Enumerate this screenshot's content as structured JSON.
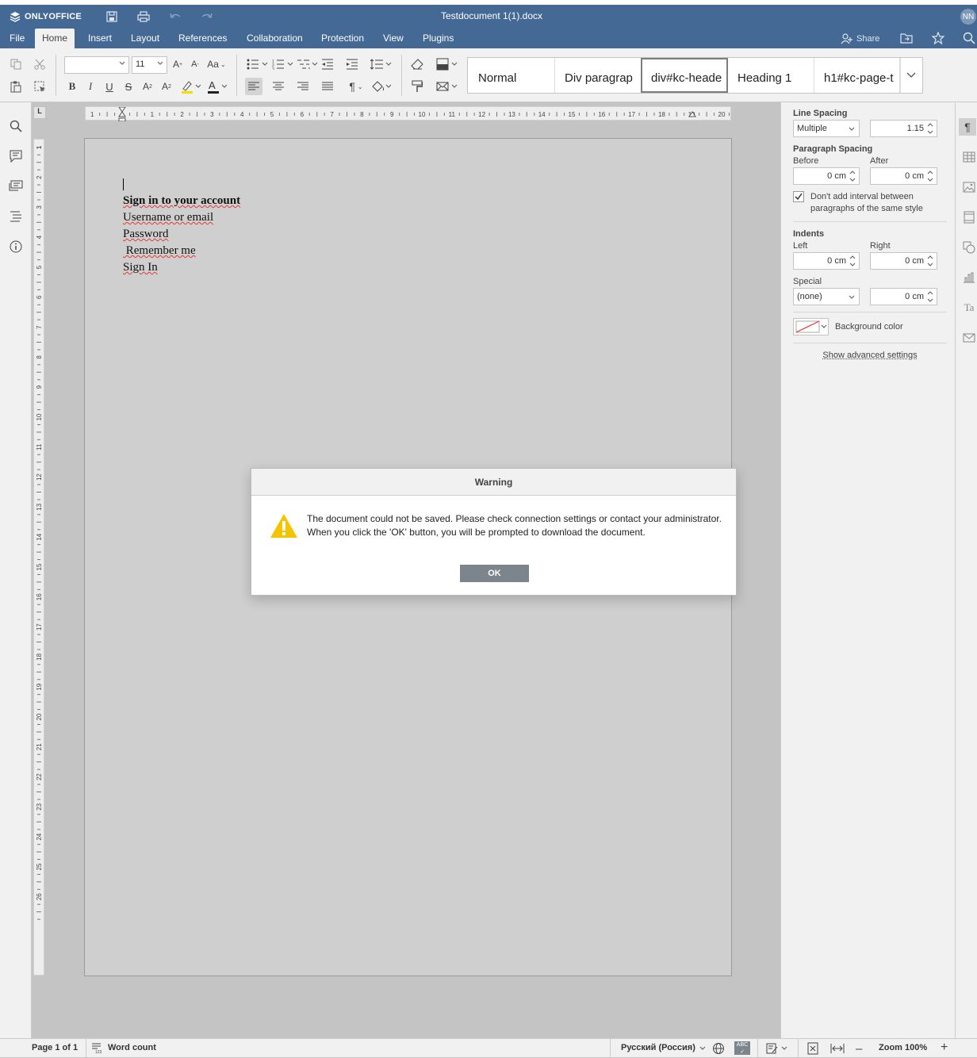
{
  "app": {
    "brand": "ONLYOFFICE",
    "doc_title": "Testdocument 1(1).docx",
    "user_initials": "NN"
  },
  "menu": {
    "tabs": [
      "File",
      "Home",
      "Insert",
      "Layout",
      "References",
      "Collaboration",
      "Protection",
      "View",
      "Plugins"
    ],
    "active": "Home",
    "share_label": "Share"
  },
  "toolbar": {
    "font_name": "",
    "font_size": "11",
    "styles": [
      "Normal",
      "Div paragrap",
      "div#kc-heade",
      "Heading 1",
      "h1#kc-page-t"
    ],
    "selected_style": "div#kc-heade"
  },
  "document": {
    "lines": [
      {
        "text": "Sign in to your account",
        "bold": true
      },
      {
        "text": "Username or email",
        "bold": false
      },
      {
        "text": "Password",
        "bold": false
      },
      {
        "text": " Remember me",
        "bold": false
      },
      {
        "text": "Sign In",
        "bold": false
      }
    ]
  },
  "ruler": {
    "h_ticks": [
      "1",
      "1",
      "2",
      "3",
      "4",
      "5",
      "6",
      "7",
      "8",
      "9",
      "10",
      "11",
      "12",
      "13",
      "14",
      "15",
      "16",
      "17",
      "18",
      "19",
      "20"
    ],
    "v_ticks": [
      "1",
      "1",
      "2",
      "3",
      "4",
      "5",
      "6",
      "7",
      "8",
      "9",
      "10",
      "11",
      "12",
      "13",
      "14",
      "15",
      "16",
      "17",
      "18",
      "19",
      "20",
      "21",
      "22",
      "23",
      "24",
      "25",
      "26"
    ]
  },
  "paragraph_settings": {
    "line_spacing_label": "Line Spacing",
    "line_spacing_type": "Multiple",
    "line_spacing_value": "1.15",
    "paragraph_spacing_label": "Paragraph Spacing",
    "before_label": "Before",
    "before_value": "0 cm",
    "after_label": "After",
    "after_value": "0 cm",
    "dont_add_interval_label": "Don't add interval between paragraphs of the same style",
    "dont_add_interval_checked": true,
    "indents_label": "Indents",
    "left_label": "Left",
    "left_value": "0 cm",
    "right_label": "Right",
    "right_value": "0 cm",
    "special_label": "Special",
    "special_type": "(none)",
    "special_value": "0 cm",
    "background_color_label": "Background color",
    "advanced_link": "Show advanced settings"
  },
  "status": {
    "page_info": "Page 1 of 1",
    "word_count": "Word count",
    "language": "Русский (Россия)",
    "zoom": "Zoom 100%"
  },
  "dialog": {
    "title": "Warning",
    "message_line1": "The document could not be saved. Please check connection settings or contact your administrator.",
    "message_line2": "When you click the 'OK' button, you will be prompted to download the document.",
    "ok_label": "OK"
  },
  "colors": {
    "header": "#446995",
    "warning_icon": "#f5c400",
    "ok_button": "#7d858c"
  }
}
